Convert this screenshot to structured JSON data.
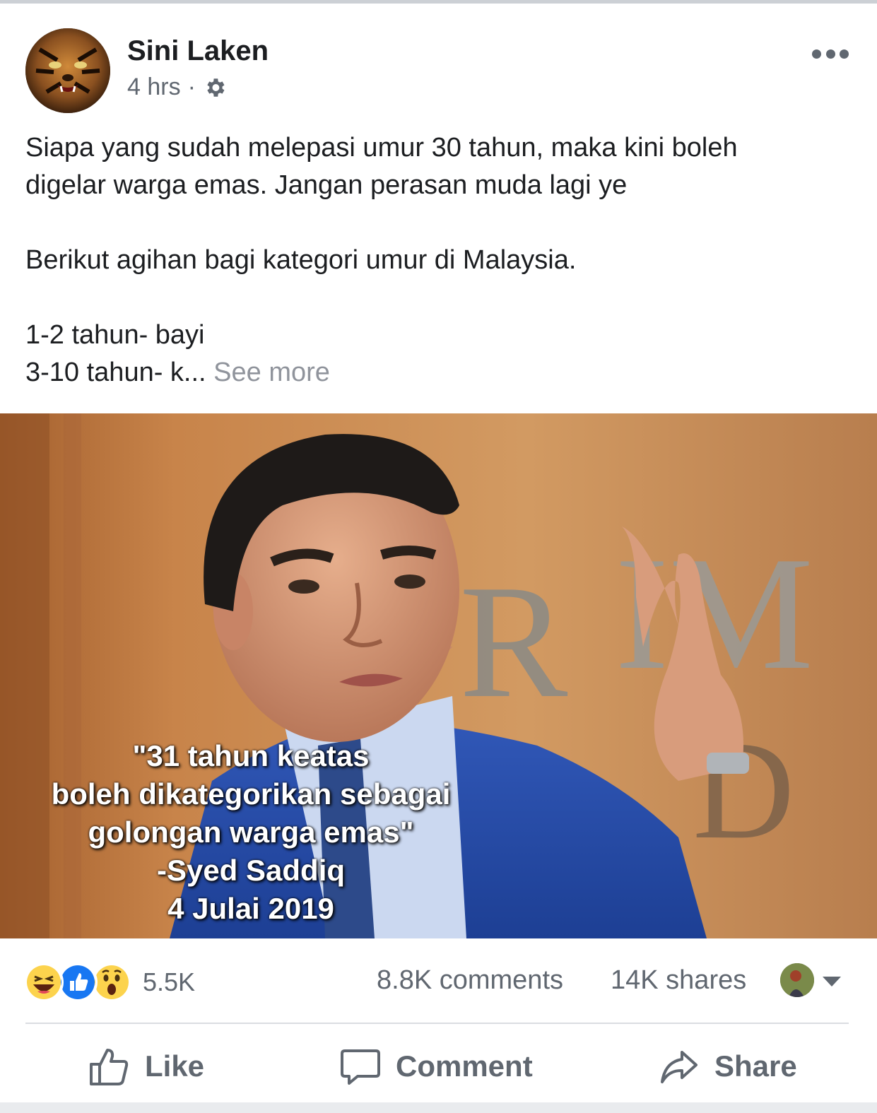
{
  "post": {
    "author": "Sini Laken",
    "time": "4 hrs",
    "separator": "·",
    "privacy_icon": "gear-icon",
    "more_icon": "more-dots-icon",
    "text_lines": [
      "Siapa yang sudah melepasi umur 30 tahun, maka kini boleh",
      "digelar warga emas. Jangan perasan muda lagi ye",
      "Berikut agihan bagi kategori umur di Malaysia.",
      "1-2 tahun- bayi",
      "3-10 tahun- k..."
    ],
    "see_more": "See more"
  },
  "image": {
    "caption_lines": [
      "\"31 tahun keatas",
      "boleh dikategorikan sebagai",
      "golongan warga emas\"",
      "-Syed Saddiq",
      "4 Julai 2019"
    ],
    "background_letters": "RIM"
  },
  "stats": {
    "reaction_icons": [
      "haha-icon",
      "like-icon",
      "wow-icon"
    ],
    "reactions_count": "5.5K",
    "comments": "8.8K comments",
    "shares": "14K shares"
  },
  "actions": {
    "like": "Like",
    "comment": "Comment",
    "share": "Share"
  },
  "colors": {
    "text": "#1c1e21",
    "secondary": "#606770",
    "like_blue": "#1877f2",
    "reaction_yellow": "#fcd34d",
    "divider": "#dadde1"
  }
}
